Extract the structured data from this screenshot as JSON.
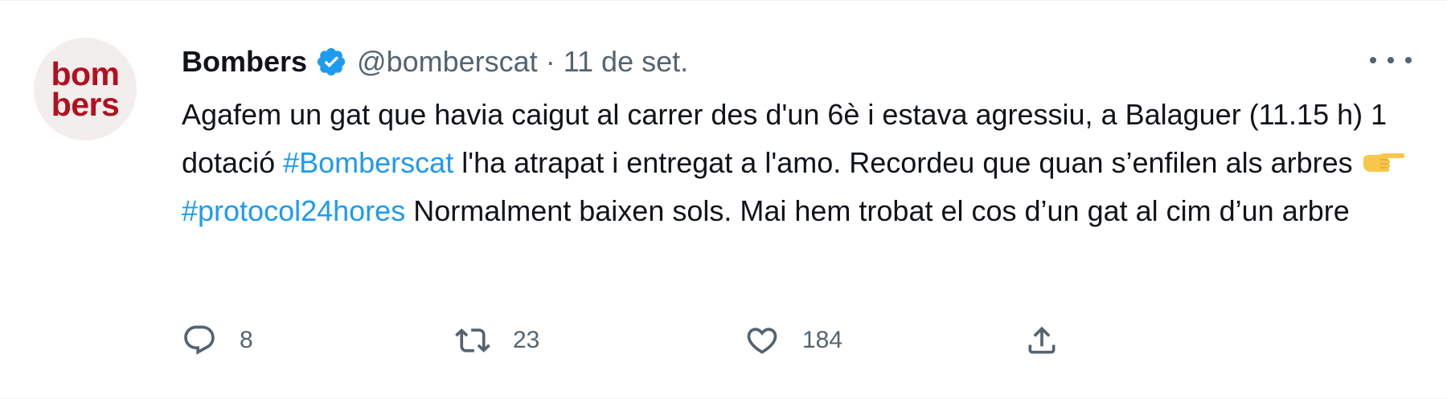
{
  "tweet": {
    "avatar": {
      "line1": "bom",
      "line2": "bers",
      "color": "#b3101e"
    },
    "author": {
      "name": "Bombers",
      "verified": true,
      "handle": "@bomberscat"
    },
    "separator": "·",
    "date": "11 de set.",
    "more_icon": "more-horizontal-icon",
    "text": {
      "part1": "Agafem un gat que havia caigut al carrer des d'un 6è i estava agressiu, a Balaguer (11.15 h) 1 dotació ",
      "hashtag1": "#Bomberscat",
      "part2": " l'ha atrapat i entregat a l'amo. Recordeu que quan s’enfilen als arbres ",
      "emoji": "pointing-right-hand-emoji",
      "hashtag2": "#protocol24hores",
      "part3": " Normalment baixen sols. Mai hem trobat el cos d’un gat al cim d’un arbre"
    },
    "actions": {
      "reply": {
        "icon": "reply-icon",
        "count": "8"
      },
      "retweet": {
        "icon": "retweet-icon",
        "count": "23"
      },
      "like": {
        "icon": "heart-icon",
        "count": "184"
      },
      "share": {
        "icon": "share-icon"
      }
    },
    "colors": {
      "link": "#1d9bf0",
      "secondary": "#536471",
      "primary": "#0f1419"
    }
  }
}
